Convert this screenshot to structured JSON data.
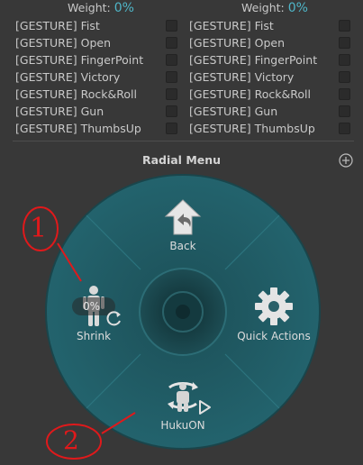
{
  "weights": {
    "left": {
      "label": "Weight:",
      "value": "0%"
    },
    "right": {
      "label": "Weight:",
      "value": "0%"
    }
  },
  "gestures_left": [
    {
      "label": "[GESTURE] Fist"
    },
    {
      "label": "[GESTURE] Open"
    },
    {
      "label": "[GESTURE] FingerPoint"
    },
    {
      "label": "[GESTURE] Victory"
    },
    {
      "label": "[GESTURE] Rock&Roll"
    },
    {
      "label": "[GESTURE] Gun"
    },
    {
      "label": "[GESTURE] ThumbsUp"
    }
  ],
  "gestures_right": [
    {
      "label": "[GESTURE] Fist"
    },
    {
      "label": "[GESTURE] Open"
    },
    {
      "label": "[GESTURE] FingerPoint"
    },
    {
      "label": "[GESTURE] Victory"
    },
    {
      "label": "[GESTURE] Rock&Roll"
    },
    {
      "label": "[GESTURE] Gun"
    },
    {
      "label": "[GESTURE] ThumbsUp"
    }
  ],
  "radial_menu": {
    "title": "Radial Menu",
    "items": {
      "top": {
        "label": "Back",
        "icon": "back-arrow-icon"
      },
      "right": {
        "label": "Quick Actions",
        "icon": "gear-icon"
      },
      "bottom": {
        "label": "HukuON",
        "icon": "avatar-rotate-icon"
      },
      "left": {
        "label": "Shrink",
        "icon": "person-icon",
        "weight": "0%"
      }
    }
  },
  "annotations": {
    "one": "1",
    "two": "2"
  },
  "colors": {
    "background": "#383838",
    "accent": "#4fb6c8",
    "radial_fill": "#1f5a63",
    "annotation": "#e0191b"
  }
}
